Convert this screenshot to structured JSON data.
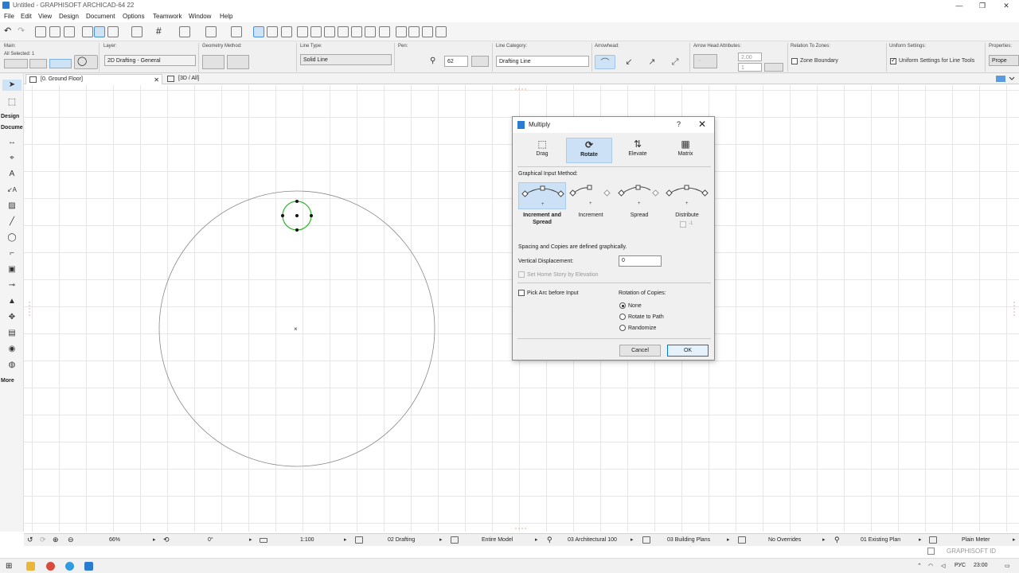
{
  "window": {
    "title": "Untitled - GRAPHISOFT ARCHICAD-64 22"
  },
  "menu": [
    "File",
    "Edit",
    "View",
    "Design",
    "Document",
    "Options",
    "Teamwork",
    "Window",
    "Help"
  ],
  "infobox": {
    "main_label": "Main:",
    "selection": "All Selected: 1",
    "layer_label": "Layer:",
    "layer_value": "2D Drafting - General",
    "geometry_label": "Geometry Method:",
    "linetype_label": "Line Type:",
    "linetype_value": "Solid Line",
    "pen_label": "Pen:",
    "pen_value": "62",
    "linecat_label": "Line Category:",
    "linecat_value": "Drafting Line",
    "arrowhead_label": "Arrowhead:",
    "arrowattr_label": "Arrow Head Attributes:",
    "arrow_size": "2,00",
    "arrow_pen": "1",
    "zones_label": "Relation To Zones:",
    "zones_value": "Zone Boundary",
    "uniform_label": "Uniform Settings:",
    "uniform_value": "Uniform Settings for Line Tools",
    "properties_label": "Properties:",
    "properties_value": "Prope"
  },
  "toolbox": {
    "design": "Design",
    "document": "Docume",
    "more": "More"
  },
  "tabs": [
    {
      "label": "[0. Ground Floor]"
    },
    {
      "label": "[3D / All]"
    }
  ],
  "dialog": {
    "title": "Multiply",
    "help": "?",
    "close": "✕",
    "modes": [
      {
        "label": "Drag",
        "glyph": "⬚"
      },
      {
        "label": "Rotate",
        "glyph": "⟳"
      },
      {
        "label": "Elevate",
        "glyph": "⇅"
      },
      {
        "label": "Matrix",
        "glyph": "▦"
      }
    ],
    "method_label": "Graphical Input Method:",
    "methods": [
      {
        "label": "Increment and Spread"
      },
      {
        "label": "Increment"
      },
      {
        "label": "Spread"
      },
      {
        "label": "Distribute"
      }
    ],
    "distribute_hint": "-1",
    "info_text": "Spacing and Copies are defined graphically.",
    "vertical_label": "Vertical Displacement:",
    "vertical_value": "0",
    "home_story": "Set Home Story by Elevation",
    "pick_arc": "Pick Arc before Input",
    "rotation_label": "Rotation of Copies:",
    "rotation_options": [
      "None",
      "Rotate to Path",
      "Randomize"
    ],
    "cancel": "Cancel",
    "ok": "OK"
  },
  "statusbar": {
    "zoom": "66%",
    "angle": "0°",
    "scale": "1:100",
    "layer_combo": "02 Drafting",
    "model": "Entire Model",
    "pen_set": "03 Architectural 100",
    "mvo": "03 Building Plans",
    "overrides": "No Overrides",
    "renovation": "01 Existing Plan",
    "dimension": "Plain Meter"
  },
  "graphisoft_id": "GRAPHISOFT ID",
  "taskbar": {
    "lang": "РУС",
    "time": "23:00"
  },
  "colors": {
    "accent": "#cce1f6",
    "selection_green": "#2db52d"
  }
}
